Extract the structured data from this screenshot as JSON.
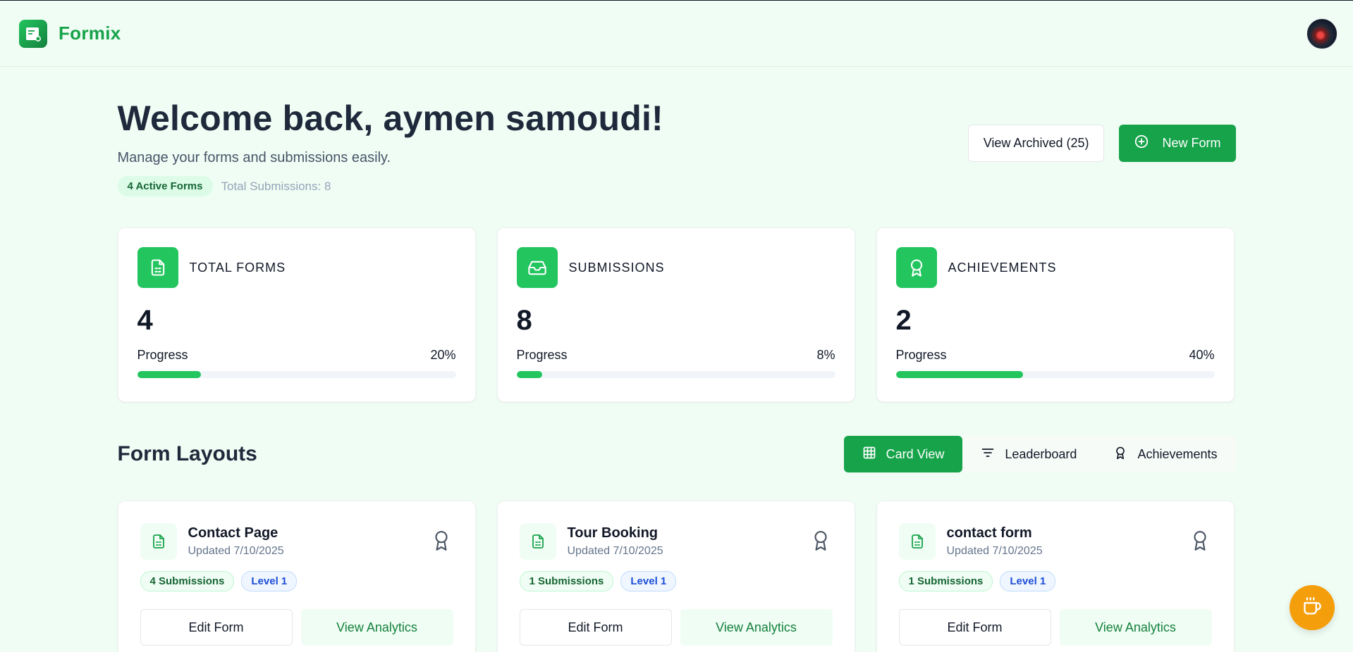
{
  "header": {
    "brand_name": "Formix"
  },
  "welcome": {
    "title": "Welcome back, aymen samoudi!",
    "subtitle": "Manage your forms and submissions easily.",
    "active_forms": "4 Active Forms",
    "total_submissions": "Total Submissions: 8",
    "view_archived_label": "View Archived (25)",
    "new_form_label": "New Form"
  },
  "stats": [
    {
      "label": "TOTAL FORMS",
      "value": "4",
      "progress_label": "Progress",
      "progress_text": "20%",
      "progress": 20,
      "icon": "file-text-icon"
    },
    {
      "label": "SUBMISSIONS",
      "value": "8",
      "progress_label": "Progress",
      "progress_text": "8%",
      "progress": 8,
      "icon": "inbox-icon"
    },
    {
      "label": "ACHIEVEMENTS",
      "value": "2",
      "progress_label": "Progress",
      "progress_text": "40%",
      "progress": 40,
      "icon": "award-icon"
    }
  ],
  "layouts": {
    "title": "Form Layouts",
    "views": [
      {
        "label": "Card View",
        "icon": "grid-icon",
        "active": true
      },
      {
        "label": "Leaderboard",
        "icon": "filter-icon",
        "active": false
      },
      {
        "label": "Achievements",
        "icon": "award-icon",
        "active": false
      }
    ]
  },
  "forms": [
    {
      "title": "Contact Page",
      "updated": "Updated 7/10/2025",
      "submissions": "4 Submissions",
      "level": "Level 1",
      "edit_label": "Edit Form",
      "analytics_label": "View Analytics"
    },
    {
      "title": "Tour Booking",
      "updated": "Updated 7/10/2025",
      "submissions": "1 Submissions",
      "level": "Level 1",
      "edit_label": "Edit Form",
      "analytics_label": "View Analytics"
    },
    {
      "title": "contact form",
      "updated": "Updated 7/10/2025",
      "submissions": "1 Submissions",
      "level": "Level 1",
      "edit_label": "Edit Form",
      "analytics_label": "View Analytics"
    }
  ],
  "colors": {
    "brand": "#16a34a",
    "accent": "#22c55e",
    "background": "#f0fdf4",
    "fab": "#f59e0b"
  }
}
